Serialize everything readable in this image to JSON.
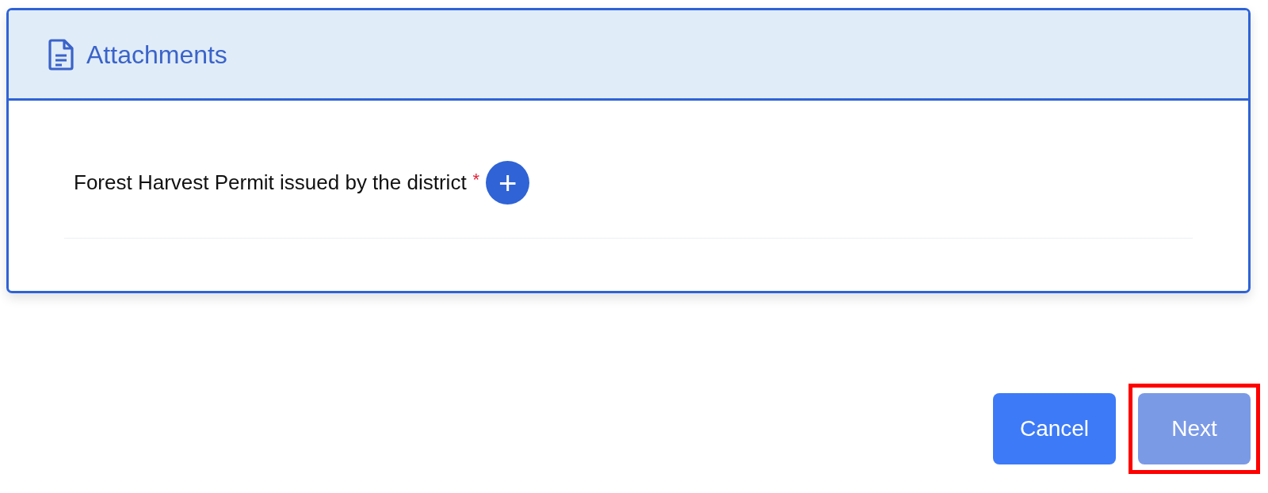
{
  "card": {
    "title": "Attachments",
    "fields": [
      {
        "label": "Forest Harvest Permit issued by the district",
        "required": true,
        "required_mark": "*",
        "add_button": "+"
      }
    ]
  },
  "buttons": [
    {
      "label": "Cancel",
      "disabled": false,
      "highlighted": false
    },
    {
      "label": "Next",
      "disabled": true,
      "highlighted": true
    }
  ]
}
